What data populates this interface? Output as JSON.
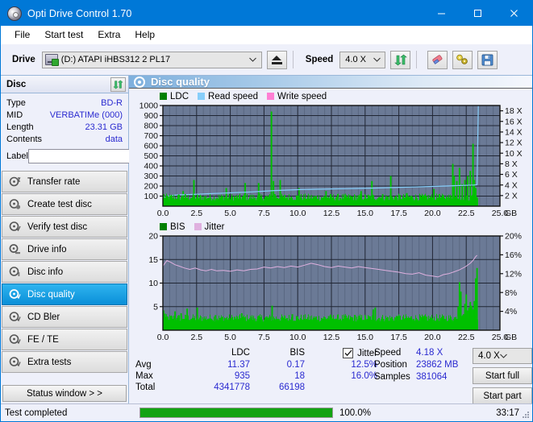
{
  "window": {
    "title": "Opti Drive Control 1.70",
    "icon": "disc-icon",
    "minimize": "minimize-icon",
    "maximize": "maximize-icon",
    "close": "close-icon"
  },
  "menu": {
    "items": [
      "File",
      "Start test",
      "Extra",
      "Help"
    ]
  },
  "toolbar": {
    "drive_label": "Drive",
    "drive_value": "(D:)  ATAPI iHBS312  2 PL17",
    "eject_icon": "eject-icon",
    "speed_label": "Speed",
    "speed_value": "4.0 X",
    "refresh_icon": "refresh-icon",
    "erase_icon": "eraser-icon",
    "tools_icon": "tools-icon",
    "save_icon": "save-icon"
  },
  "disc_panel": {
    "header": "Disc",
    "refresh_icon": "refresh-icon",
    "rows": [
      {
        "key": "Type",
        "value": "BD-R"
      },
      {
        "key": "MID",
        "value": "VERBATIMe (000)"
      },
      {
        "key": "Length",
        "value": "23.31 GB"
      },
      {
        "key": "Contents",
        "value": "data"
      }
    ],
    "label_key": "Label",
    "label_value": "",
    "label_button_icon": "cd-icon"
  },
  "nav": {
    "items": [
      {
        "label": "Transfer rate",
        "icon": "disc-arrow-icon",
        "active": false
      },
      {
        "label": "Create test disc",
        "icon": "disc-write-icon",
        "active": false
      },
      {
        "label": "Verify test disc",
        "icon": "disc-check-icon",
        "active": false
      },
      {
        "label": "Drive info",
        "icon": "drive-info-icon",
        "active": false
      },
      {
        "label": "Disc info",
        "icon": "disc-info-icon",
        "active": false
      },
      {
        "label": "Disc quality",
        "icon": "disc-quality-icon",
        "active": true
      },
      {
        "label": "CD Bler",
        "icon": "disc-bler-icon",
        "active": false
      },
      {
        "label": "FE / TE",
        "icon": "disc-fete-icon",
        "active": false
      },
      {
        "label": "Extra tests",
        "icon": "disc-extra-icon",
        "active": false
      }
    ],
    "status_window_button": "Status window > >"
  },
  "panel": {
    "title": "Disc quality",
    "icon": "disc-quality-icon"
  },
  "chart_data": [
    {
      "type": "line",
      "name": "top-chart",
      "title": "",
      "legend": [
        {
          "label": "LDC",
          "color": "#008000"
        },
        {
          "label": "Read speed",
          "color": "#87cefa"
        },
        {
          "label": "Write speed",
          "color": "#ff7fd4"
        }
      ],
      "legend_position": "top-left",
      "grid": true,
      "xlabel": "GB",
      "xlim": [
        0.0,
        25.0
      ],
      "xticks": [
        "0.0",
        "2.5",
        "5.0",
        "7.5",
        "10.0",
        "12.5",
        "15.0",
        "17.5",
        "20.0",
        "22.5",
        "25.0"
      ],
      "xunit": "GB",
      "ylabel_left": "LDC",
      "ylim_left": [
        0,
        1000
      ],
      "yticks_left": [
        "100",
        "200",
        "300",
        "400",
        "500",
        "600",
        "700",
        "800",
        "900",
        "1000"
      ],
      "ylabel_right": "speed",
      "ylim_right": [
        0,
        19
      ],
      "yticks_right": [
        "2 X",
        "4 X",
        "6 X",
        "8 X",
        "10 X",
        "12 X",
        "14 X",
        "16 X",
        "18 X"
      ],
      "series": [
        {
          "name": "LDC",
          "color": "#00c000",
          "render": "bars",
          "x": [
            0.05,
            0.2,
            0.35,
            0.5,
            0.7,
            0.9,
            1.1,
            1.3,
            1.5,
            1.7,
            1.9,
            2.1,
            2.3,
            2.45,
            2.5,
            2.7,
            2.9,
            3.1,
            3.3,
            3.5,
            3.7,
            3.9,
            4.1,
            4.3,
            4.5,
            4.7,
            4.9,
            5.1,
            5.3,
            5.5,
            5.7,
            5.9,
            6.1,
            6.3,
            6.5,
            6.7,
            6.9,
            7.1,
            7.3,
            7.5,
            7.7,
            7.9,
            8.05,
            8.2,
            8.3,
            8.5,
            8.7,
            8.9,
            9.1,
            9.3,
            9.5,
            9.7,
            9.9,
            10.1,
            10.3,
            10.5,
            10.7,
            10.9,
            11.1,
            11.3,
            11.5,
            11.7,
            11.9,
            12.1,
            12.3,
            12.5,
            12.7,
            12.9,
            13.1,
            13.3,
            13.5,
            13.7,
            13.9,
            14.1,
            14.3,
            14.5,
            14.7,
            14.9,
            15.1,
            15.3,
            15.5,
            15.7,
            15.9,
            16.1,
            16.3,
            16.5,
            16.7,
            16.9,
            17.1,
            17.3,
            17.5,
            17.7,
            17.9,
            18.1,
            18.3,
            18.5,
            18.7,
            18.9,
            19.1,
            19.3,
            19.5,
            19.7,
            19.9,
            20.1,
            20.3,
            20.5,
            20.7,
            20.9,
            21.1,
            21.3,
            21.5,
            21.6,
            21.8,
            22.0,
            22.2,
            22.4,
            22.6,
            22.8,
            23.0,
            23.1,
            23.2,
            23.3
          ],
          "values": [
            120,
            80,
            70,
            90,
            65,
            60,
            75,
            60,
            150,
            70,
            60,
            55,
            260,
            60,
            55,
            70,
            60,
            90,
            60,
            55,
            65,
            60,
            55,
            70,
            60,
            180,
            60,
            55,
            60,
            90,
            55,
            60,
            230,
            60,
            55,
            70,
            60,
            230,
            70,
            60,
            75,
            110,
            940,
            250,
            120,
            70,
            260,
            60,
            55,
            60,
            90,
            60,
            55,
            180,
            60,
            55,
            70,
            60,
            55,
            60,
            70,
            60,
            55,
            150,
            60,
            55,
            60,
            95,
            55,
            60,
            70,
            60,
            90,
            55,
            60,
            70,
            150,
            60,
            55,
            60,
            250,
            60,
            55,
            90,
            120,
            70,
            60,
            300,
            55,
            60,
            70,
            60,
            55,
            130,
            60,
            95,
            60,
            55,
            80,
            60,
            55,
            70,
            60,
            170,
            60,
            120,
            60,
            55,
            90,
            60,
            420,
            300,
            250,
            380,
            220,
            260,
            300,
            350,
            620,
            260,
            180,
            90
          ]
        },
        {
          "name": "Read speed",
          "color": "#87cefa",
          "render": "line",
          "x": [
            0.0,
            0.6,
            1.2,
            2.3,
            3.4,
            4.5,
            5.6,
            6.6,
            7.4,
            8.3,
            9.2,
            10.2,
            11.3,
            12.4,
            13.5,
            14.6,
            15.7,
            16.8,
            17.9,
            19.0,
            20.0,
            21.0,
            22.0,
            23.0,
            23.3,
            23.35,
            23.4
          ],
          "values": [
            88,
            105,
            112,
            118,
            124,
            130,
            136,
            142,
            148,
            155,
            160,
            165,
            168,
            171,
            174,
            177,
            180,
            184,
            188,
            192,
            196,
            200,
            205,
            210,
            213,
            600,
            1000
          ]
        }
      ]
    },
    {
      "type": "line",
      "name": "bottom-chart",
      "title": "",
      "legend": [
        {
          "label": "BIS",
          "color": "#008000"
        },
        {
          "label": "Jitter",
          "color": "#dfb0df"
        }
      ],
      "legend_position": "top-left",
      "grid": true,
      "xlabel": "GB",
      "xlim": [
        0.0,
        25.0
      ],
      "xticks": [
        "0.0",
        "2.5",
        "5.0",
        "7.5",
        "10.0",
        "12.5",
        "15.0",
        "17.5",
        "20.0",
        "22.5",
        "25.0"
      ],
      "xunit": "GB",
      "ylabel_left": "BIS",
      "ylim_left": [
        0,
        20
      ],
      "yticks_left": [
        "5",
        "10",
        "15",
        "20"
      ],
      "ylabel_right": "Jitter",
      "ylim_right": [
        0,
        20
      ],
      "yticks_right": [
        "4%",
        "8%",
        "12%",
        "16%",
        "20%"
      ],
      "series": [
        {
          "name": "BIS",
          "color": "#00c000",
          "render": "bars",
          "x": [
            0.05,
            0.15,
            0.3,
            0.45,
            0.6,
            0.75,
            0.9,
            1.05,
            1.2,
            1.35,
            1.5,
            1.65,
            1.8,
            1.95,
            2.1,
            2.25,
            2.4,
            2.55,
            2.7,
            2.85,
            3.0,
            3.15,
            3.3,
            3.45,
            3.6,
            3.75,
            3.9,
            4.05,
            4.2,
            4.35,
            4.5,
            4.65,
            4.8,
            4.95,
            5.1,
            5.25,
            5.4,
            5.55,
            5.7,
            5.85,
            6.0,
            6.15,
            6.3,
            6.45,
            6.6,
            6.75,
            6.9,
            7.05,
            7.2,
            7.35,
            7.5,
            7.65,
            7.8,
            7.95,
            8.1,
            8.25,
            8.4,
            8.55,
            8.7,
            8.85,
            9.0,
            9.15,
            9.3,
            9.45,
            9.6,
            9.75,
            9.9,
            10.05,
            10.2,
            10.35,
            10.5,
            10.65,
            10.8,
            10.95,
            11.1,
            11.25,
            11.4,
            11.55,
            11.7,
            11.85,
            12.0,
            12.15,
            12.3,
            12.45,
            12.6,
            12.75,
            12.9,
            13.05,
            13.2,
            13.35,
            13.5,
            13.65,
            13.8,
            13.95,
            14.1,
            14.25,
            14.4,
            14.55,
            14.7,
            14.85,
            15.0,
            15.15,
            15.3,
            15.45,
            15.6,
            15.75,
            15.9,
            16.05,
            16.2,
            16.35,
            16.5,
            16.65,
            16.8,
            16.95,
            17.1,
            17.25,
            17.4,
            17.55,
            17.7,
            17.85,
            18.0,
            18.15,
            18.3,
            18.45,
            18.6,
            18.75,
            18.9,
            19.05,
            19.2,
            19.35,
            19.5,
            19.65,
            19.8,
            19.95,
            20.1,
            20.25,
            20.4,
            20.55,
            20.7,
            20.85,
            21.0,
            21.15,
            21.3,
            21.45,
            21.6,
            21.7,
            21.8,
            21.9,
            22.0,
            22.1,
            22.2,
            22.3,
            22.4,
            22.5,
            22.6,
            22.7,
            22.8,
            22.9,
            23.0,
            23.1,
            23.2,
            23.3
          ],
          "values": [
            4.2,
            3.5,
            2.6,
            2.2,
            3.0,
            2.4,
            4.0,
            2.6,
            2.1,
            3.6,
            2.4,
            2.0,
            4.6,
            2.2,
            1.8,
            2.4,
            2.0,
            4.8,
            2.2,
            1.9,
            2.4,
            2.0,
            2.2,
            1.9,
            2.4,
            2.0,
            3.2,
            2.0,
            1.9,
            2.4,
            2.0,
            2.2,
            1.9,
            2.6,
            2.0,
            2.2,
            1.9,
            2.4,
            2.0,
            3.6,
            2.0,
            1.9,
            2.4,
            2.0,
            2.8,
            2.0,
            1.9,
            2.4,
            2.0,
            2.2,
            1.9,
            2.6,
            2.0,
            2.2,
            5.2,
            2.2,
            1.9,
            2.4,
            2.0,
            2.2,
            1.9,
            2.4,
            2.0,
            2.2,
            3.4,
            2.0,
            1.9,
            2.4,
            2.0,
            2.2,
            1.9,
            2.4,
            2.0,
            2.2,
            1.9,
            2.4,
            2.0,
            2.2,
            1.9,
            2.4,
            2.0,
            2.2,
            3.0,
            2.0,
            1.9,
            2.4,
            2.0,
            2.2,
            1.9,
            2.4,
            2.0,
            2.2,
            1.9,
            2.4,
            2.0,
            3.2,
            1.9,
            2.4,
            2.0,
            2.2,
            1.9,
            2.4,
            2.0,
            2.2,
            4.4,
            4.8,
            2.0,
            2.2,
            1.9,
            2.4,
            2.0,
            2.2,
            1.9,
            2.4,
            2.0,
            2.2,
            3.0,
            2.0,
            2.2,
            1.9,
            2.4,
            2.0,
            2.2,
            1.9,
            2.4,
            2.0,
            2.2,
            1.9,
            2.4,
            2.0,
            2.2,
            1.9,
            2.4,
            2.0,
            2.2,
            1.9,
            2.4,
            2.0,
            2.2,
            1.9,
            2.4,
            2.0,
            2.2,
            1.9,
            2.4,
            2.0,
            2.4,
            5.0,
            10.2,
            8.2,
            3.0,
            3.4,
            5.6,
            7.6,
            4.2,
            4.8,
            6.0,
            5.2,
            4.4,
            6.2,
            11.0,
            13.2,
            5.0,
            1.0
          ]
        },
        {
          "name": "Jitter",
          "color": "#dfb0df",
          "render": "line",
          "x": [
            0.0,
            0.3,
            0.6,
            0.9,
            1.2,
            1.6,
            2.0,
            2.4,
            2.8,
            3.2,
            3.6,
            4.0,
            4.5,
            5.0,
            5.5,
            6.0,
            6.5,
            7.0,
            7.5,
            8.0,
            8.5,
            9.0,
            9.5,
            10.0,
            10.5,
            11.0,
            11.5,
            12.0,
            12.5,
            13.0,
            13.5,
            14.0,
            14.5,
            15.0,
            15.5,
            16.0,
            16.5,
            17.0,
            17.5,
            18.0,
            18.5,
            19.0,
            19.5,
            20.0,
            20.4,
            20.8,
            21.2,
            21.6,
            22.0,
            22.4,
            22.8,
            23.0,
            23.2,
            23.3
          ],
          "values": [
            13.6,
            14.8,
            14.4,
            13.9,
            13.6,
            13.2,
            12.9,
            13.2,
            12.8,
            12.6,
            12.9,
            12.6,
            12.7,
            12.5,
            12.8,
            12.6,
            12.9,
            13.0,
            13.4,
            13.2,
            13.5,
            13.3,
            13.6,
            13.4,
            13.8,
            14.2,
            13.9,
            13.5,
            13.3,
            13.6,
            13.4,
            13.2,
            13.5,
            13.3,
            13.1,
            12.9,
            12.7,
            12.5,
            12.3,
            12.0,
            11.9,
            12.2,
            11.7,
            11.5,
            11.3,
            11.8,
            12.0,
            12.4,
            12.8,
            13.4,
            14.2,
            14.8,
            15.6,
            15.9
          ]
        }
      ]
    }
  ],
  "stats": {
    "columns": [
      "LDC",
      "BIS"
    ],
    "jitter_label": "Jitter",
    "jitter_checked": true,
    "rows": [
      {
        "label": "Avg",
        "ldc": "11.37",
        "bis": "0.17",
        "jitter": "12.5%"
      },
      {
        "label": "Max",
        "ldc": "935",
        "bis": "18",
        "jitter": "16.0%"
      },
      {
        "label": "Total",
        "ldc": "4341778",
        "bis": "66198",
        "jitter": ""
      }
    ],
    "right": [
      {
        "key": "Speed",
        "value": "4.18 X"
      },
      {
        "key": "Position",
        "value": "23862 MB"
      },
      {
        "key": "Samples",
        "value": "381064"
      }
    ],
    "speed_select": "4.0 X",
    "start_full": "Start full",
    "start_part": "Start part"
  },
  "statusbar": {
    "message": "Test completed",
    "progress_percent": 100.0,
    "progress_text": "100.0%",
    "elapsed": "33:17"
  },
  "colors": {
    "accent": "#0078d7",
    "plot_bg": "#6b7a96",
    "ldc_green": "#00c000",
    "read_speed": "#87cefa",
    "write_speed": "#ff7fd4",
    "jitter_pink": "#dfb0df",
    "value_blue": "#2a2ad0",
    "progress_green": "#13a313"
  }
}
